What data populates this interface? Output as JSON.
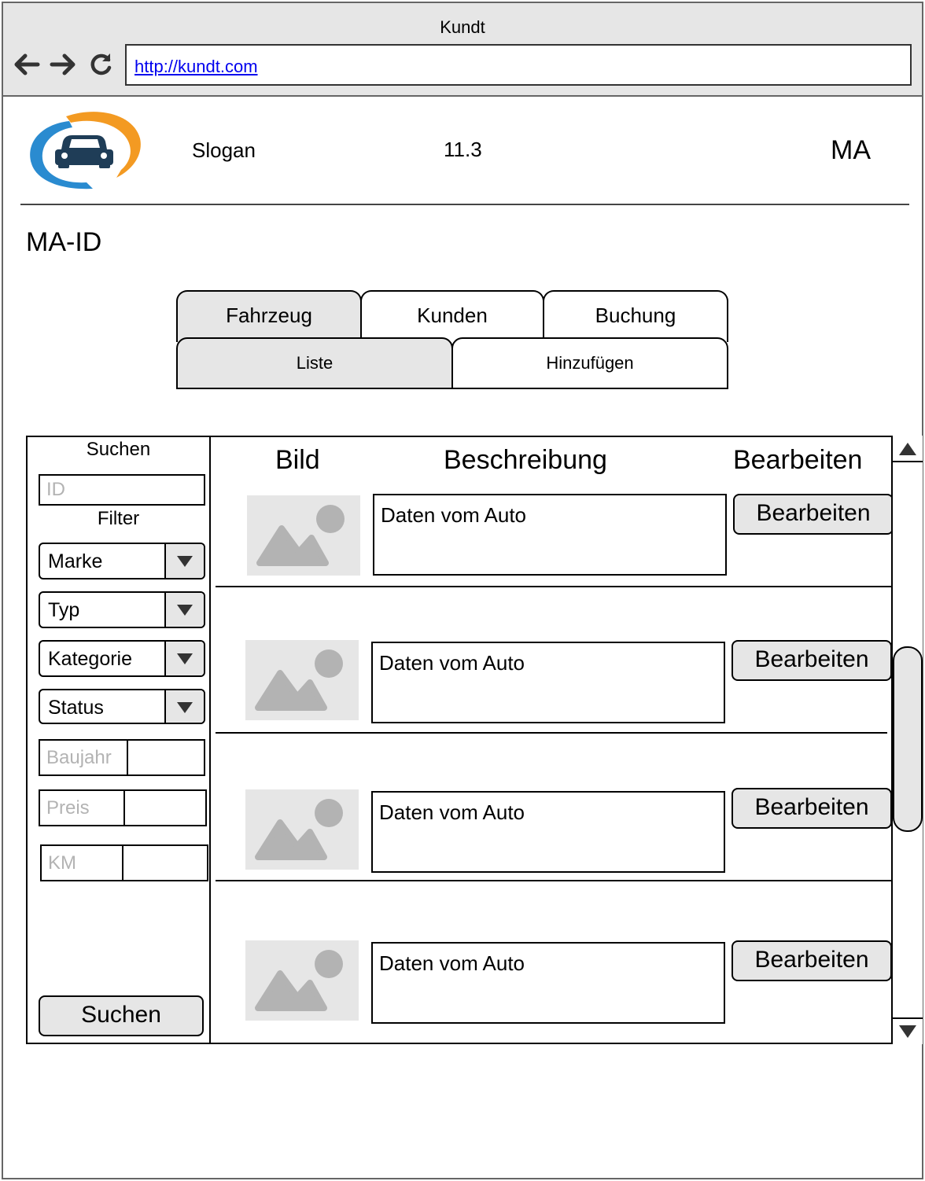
{
  "browser": {
    "title": "Kundt",
    "url": "http://kundt.com"
  },
  "header": {
    "slogan": "Slogan",
    "version": "11.3",
    "user": "MA",
    "logo_icon": "car-logo-icon"
  },
  "page": {
    "id_label": "MA-ID"
  },
  "tabs": [
    "Fahrzeug",
    "Kunden",
    "Buchung"
  ],
  "subtabs": [
    "Liste",
    "Hinzufügen"
  ],
  "sidebar": {
    "search_title": "Suchen",
    "id_placeholder": "ID",
    "filter_title": "Filter",
    "selects": [
      "Marke",
      "Typ",
      "Kategorie",
      "Status"
    ],
    "ranges": [
      "Baujahr",
      "Preis",
      "KM"
    ],
    "search_button": "Suchen"
  },
  "table": {
    "columns": [
      "Bild",
      "Beschreibung",
      "Bearbeiten"
    ],
    "rows": [
      {
        "description": "Daten vom Auto",
        "action": "Bearbeiten"
      },
      {
        "description": "Daten vom Auto",
        "action": "Bearbeiten"
      },
      {
        "description": "Daten vom Auto",
        "action": "Bearbeiten"
      },
      {
        "description": "Daten vom Auto",
        "action": "Bearbeiten"
      }
    ]
  },
  "colors": {
    "chrome": "#e6e6e6",
    "logo_blue": "#2a8bd0",
    "logo_orange": "#f39a22",
    "car": "#1f3d57"
  }
}
